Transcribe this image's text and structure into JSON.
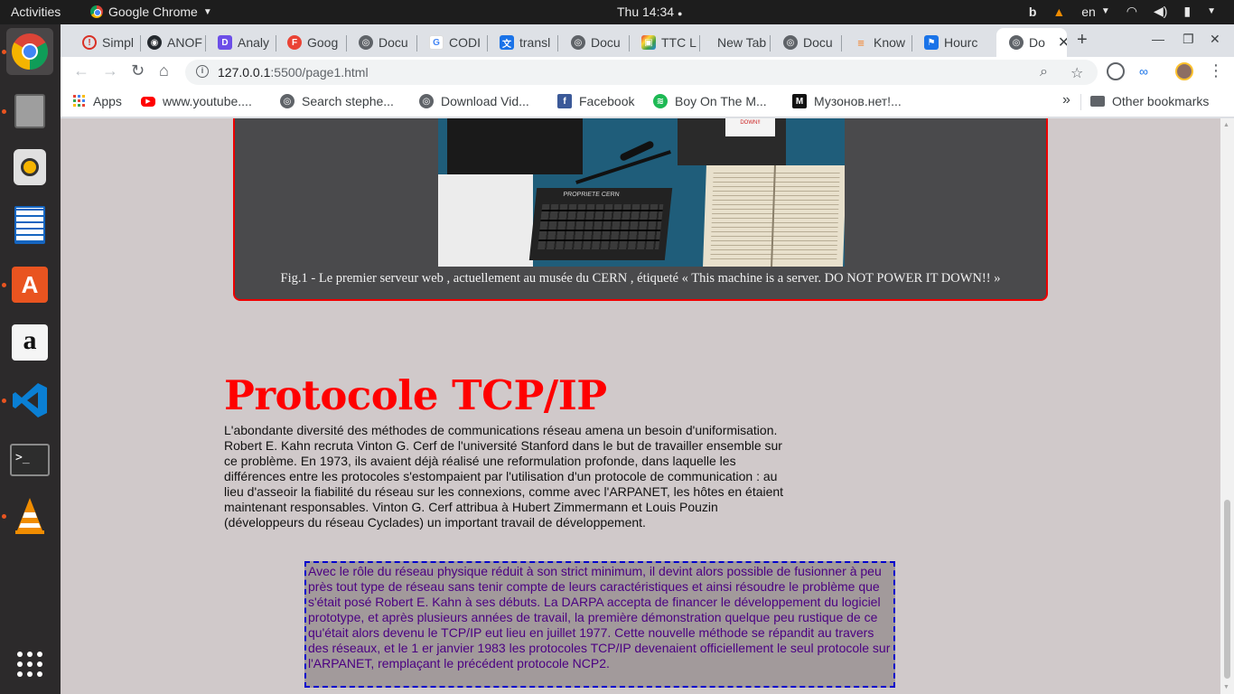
{
  "system": {
    "activities": "Activities",
    "app_name": "Google Chrome",
    "clock": "Thu 14:34",
    "keyboard_layout": "en"
  },
  "browser": {
    "tabs": [
      {
        "label": "Simpl",
        "icon": "simplenote-icon",
        "color": "#d93025"
      },
      {
        "label": "ANOF",
        "icon": "github-icon",
        "color": "#24292e"
      },
      {
        "label": "Analy",
        "icon": "analytics-icon",
        "color": "#6c4ee8"
      },
      {
        "label": "Goog",
        "icon": "font-icon",
        "color": "#ea4335"
      },
      {
        "label": "Docu",
        "icon": "globe-icon",
        "color": "#5f6368"
      },
      {
        "label": "CODI",
        "icon": "google-icon",
        "color": "#4285f4"
      },
      {
        "label": "transl",
        "icon": "translate-icon",
        "color": "#1a73e8"
      },
      {
        "label": "Docu",
        "icon": "globe-icon",
        "color": "#5f6368"
      },
      {
        "label": "TTC L",
        "icon": "cube-icon",
        "color": "#7b1fa2"
      },
      {
        "label": "New Tab",
        "icon": "none",
        "color": "#ffffff"
      },
      {
        "label": "Docu",
        "icon": "globe-icon",
        "color": "#5f6368"
      },
      {
        "label": "Know",
        "icon": "stackoverflow-icon",
        "color": "#f48024"
      },
      {
        "label": "Hourc",
        "icon": "flag-icon",
        "color": "#1a73e8"
      },
      {
        "label": "Do",
        "icon": "globe-icon",
        "color": "#5f6368",
        "active": true
      }
    ],
    "url_host": "127.0.0.1",
    "url_path": ":5500/page1.html",
    "bookmarks": [
      {
        "label": "Apps",
        "icon": "apps-grid-icon"
      },
      {
        "label": "www.youtube....",
        "icon": "youtube-icon"
      },
      {
        "label": "Search stephe...",
        "icon": "globe-icon"
      },
      {
        "label": "Download Vid...",
        "icon": "globe-icon"
      },
      {
        "label": "Facebook",
        "icon": "facebook-icon"
      },
      {
        "label": "Boy On The M...",
        "icon": "spotify-icon"
      },
      {
        "label": "Музонов.нет!...",
        "icon": "muzonov-icon"
      }
    ],
    "bookmarks_overflow": "»",
    "other_bookmarks": "Other bookmarks"
  },
  "page": {
    "photo_sign_text": "DO NOT POWER DOWN!!",
    "photo_keyboard_label": "PROPRIETE CERN",
    "figure_caption": "Fig.1 - Le premier serveur web , actuellement au musée du CERN , étiqueté «  This machine is a server. DO NOT POWER IT DOWN!!  »",
    "heading": "Protocole TCP/IP",
    "paragraph": "L'abondante diversité des méthodes de communications réseau amena un besoin d'uniformisation. Robert E. Kahn recruta Vinton G. Cerf de l'université Stanford dans le but de travailler ensemble sur ce problème. En 1973, ils avaient déjà réalisé une reformulation profonde, dans laquelle les différences entre les protocoles s'estompaient par l'utilisation d'un protocole de communication : au lieu d'asseoir la fiabilité du réseau sur les connexions, comme avec l'ARPANET, les hôtes en étaient maintenant responsables. Vinton G. Cerf attribua à Hubert Zimmermann et Louis Pouzin (développeurs du réseau Cyclades) un important travail de développement.",
    "quote": "Avec le rôle du réseau physique réduit à son strict minimum, il devint alors possible de fusionner à peu près tout type de réseau sans tenir compte de leurs caractéristiques et ainsi résoudre le problème que s'était posé Robert E. Kahn à ses débuts. La DARPA accepta de financer le développement du logiciel prototype, et après plusieurs années de travail, la première démonstration quelque peu rustique de ce qu'était alors devenu le TCP/IP eut lieu en juillet 1977. Cette nouvelle méthode se répandit au travers des réseaux, et le 1 er janvier 1983 les protocoles TCP/IP devenaient officiellement le seul protocole sur l'ARPANET, remplaçant le précédent protocole NCP2."
  },
  "colors": {
    "page_bg": "#d0c9ca",
    "heading": "#ff0000",
    "figure_border": "#ee0000",
    "quote_text": "#4b0082",
    "quote_border": "#0000cc"
  }
}
